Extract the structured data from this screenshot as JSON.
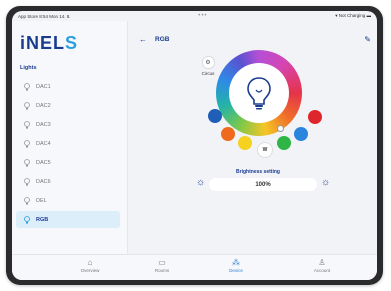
{
  "status": {
    "left": "App Store  8:54  Mon 14. 8.",
    "right": "Not Charging"
  },
  "app": {
    "logo_main": "iNEL",
    "logo_accent": "S"
  },
  "sidebar": {
    "section": "Lights",
    "items": [
      {
        "label": "DAC1"
      },
      {
        "label": "DAC2"
      },
      {
        "label": "DAC3"
      },
      {
        "label": "DAC4"
      },
      {
        "label": "DAC5"
      },
      {
        "label": "DAC6"
      },
      {
        "label": "DEL"
      },
      {
        "label": "RGB"
      }
    ]
  },
  "main": {
    "back": "←",
    "title": "RGB",
    "mode_label": "Circus",
    "white_label": "W",
    "brightness_label": "Brightness setting",
    "brightness_value": "100%"
  },
  "tabs": [
    {
      "label": "Overview"
    },
    {
      "label": "Rooms"
    },
    {
      "label": "Device"
    },
    {
      "label": "Account"
    }
  ],
  "colors": {
    "brand": "#1a3c8f",
    "accent": "#2a9fe0",
    "active_bg": "#ddeefb",
    "preset_blue": "#1f5fb8",
    "preset_red": "#e0262d",
    "preset_orange": "#f06a1e",
    "preset_yellow": "#f4d21f",
    "preset_green": "#2fb546",
    "preset_lightblue": "#2c85dc",
    "preset_red2": "#e0262d"
  }
}
